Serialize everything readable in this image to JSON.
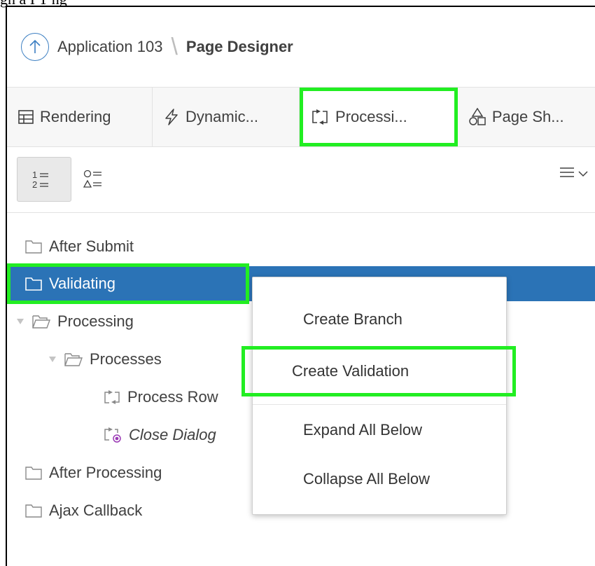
{
  "caption": "gn  a  I  T  ng",
  "breadcrumb": {
    "app": "Application 103",
    "separator": "\\",
    "page": "Page Designer"
  },
  "tabs": [
    {
      "label": "Rendering",
      "icon": "rendering-icon"
    },
    {
      "label": "Dynamic...",
      "icon": "lightning-icon"
    },
    {
      "label": "Processi...",
      "icon": "processing-icon",
      "active": true,
      "highlighted": true
    },
    {
      "label": "Page Sh...",
      "icon": "shapes-icon"
    }
  ],
  "toolbar": {
    "order_view": "1= 2=",
    "shape_view": "○= △=",
    "menu": "menu-icon"
  },
  "tree": [
    {
      "label": "After Submit",
      "level": 0,
      "type": "folder"
    },
    {
      "label": "Validating",
      "level": 0,
      "type": "folder",
      "selected": true
    },
    {
      "label": "Processing",
      "level": 0,
      "type": "folder-open",
      "expanded": true
    },
    {
      "label": "Processes",
      "level": 1,
      "type": "folder-open",
      "expanded": true
    },
    {
      "label": "Process Row",
      "level": 2,
      "type": "process"
    },
    {
      "label": "Close Dialog",
      "level": 2,
      "type": "process-dialog",
      "italic": true
    },
    {
      "label": "After Processing",
      "level": 0,
      "type": "folder"
    },
    {
      "label": "Ajax Callback",
      "level": 0,
      "type": "folder"
    }
  ],
  "context_menu": {
    "items": [
      {
        "label": "Create Branch"
      },
      {
        "label": "Create Validation",
        "highlighted": true
      },
      {
        "label": "Expand All Below"
      },
      {
        "label": "Collapse All Below"
      }
    ]
  },
  "colors": {
    "selection": "#2b73b6",
    "highlight": "#22ee22",
    "accent": "#3c7fc2"
  }
}
